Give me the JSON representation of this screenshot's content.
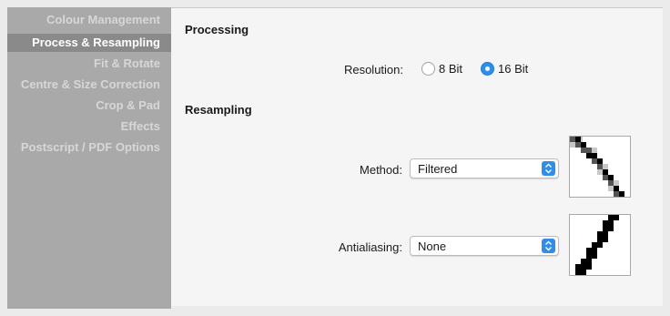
{
  "sidebar": {
    "items": [
      {
        "label": "Colour Management"
      },
      {
        "label": "Process & Resampling"
      },
      {
        "label": "Fit & Rotate"
      },
      {
        "label": "Centre & Size Correction"
      },
      {
        "label": "Crop & Pad"
      },
      {
        "label": "Effects"
      },
      {
        "label": "Postscript / PDF Options"
      }
    ]
  },
  "processing": {
    "title": "Processing",
    "resolution_label": "Resolution:",
    "options": [
      {
        "label": "8 Bit",
        "selected": false
      },
      {
        "label": "16 Bit",
        "selected": true
      }
    ]
  },
  "resampling": {
    "title": "Resampling",
    "method_label": "Method:",
    "method_value": "Filtered",
    "antialiasing_label": "Antialiasing:",
    "antialiasing_value": "None"
  },
  "colors": {
    "accent": "#2f8fe8",
    "sidebar_bg": "#a9a9a9",
    "sidebar_active_bg": "#8a8a8a"
  }
}
